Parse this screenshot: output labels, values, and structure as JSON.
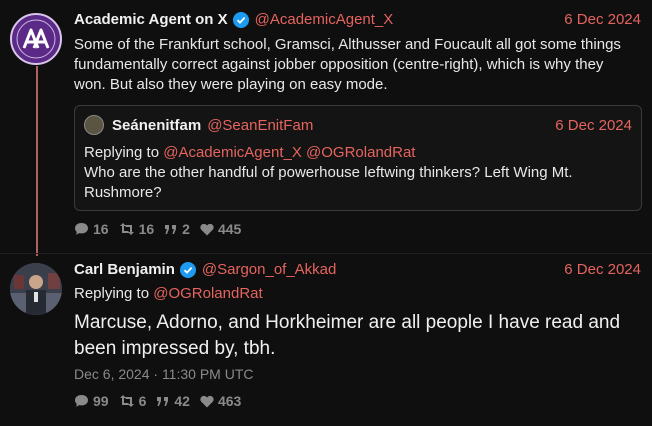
{
  "tweet1": {
    "name": "Academic Agent on X",
    "handle": "@AcademicAgent_X",
    "date": "6 Dec 2024",
    "text_line1": "Some of the Frankfurt school, Gramsci, Althusser and Foucault all got some things",
    "text_line2": "fundamentally correct against jobber opposition (centre-right), which is why they",
    "text_line3": "won. But also they were playing on easy mode.",
    "quote": {
      "name": "Seánenitfam",
      "handle": "@SeanEnitFam",
      "date": "6 Dec 2024",
      "replying_to_label": "Replying to",
      "replying_to_1": "@AcademicAgent_X",
      "replying_to_2": "@OGRolandRat",
      "text_line1": "Who are the other handful of powerhouse leftwing thinkers? Left Wing Mt.",
      "text_line2": "Rushmore?"
    },
    "stats": {
      "replies": "16",
      "retweets": "16",
      "quotes": "2",
      "likes": "445"
    }
  },
  "tweet2": {
    "name": "Carl Benjamin",
    "handle": "@Sargon_of_Akkad",
    "date": "6 Dec 2024",
    "replying_to_label": "Replying to",
    "replying_to": "@OGRolandRat",
    "text_line1": "Marcuse, Adorno, and Horkheimer are all people I have read and",
    "text_line2": "been impressed by, tbh.",
    "timestamp": "Dec 6, 2024 · 11:30 PM UTC",
    "stats": {
      "replies": "99",
      "retweets": "6",
      "quotes": "42",
      "likes": "463"
    }
  },
  "icons": {
    "verified": "verified-badge-icon",
    "reply": "comment-icon",
    "retweet": "retweet-icon",
    "quote": "quote-icon",
    "like": "heart-icon"
  },
  "colors": {
    "accent": "#e5645f",
    "verified": "#1d9bf0",
    "background": "#0f0f0f"
  }
}
